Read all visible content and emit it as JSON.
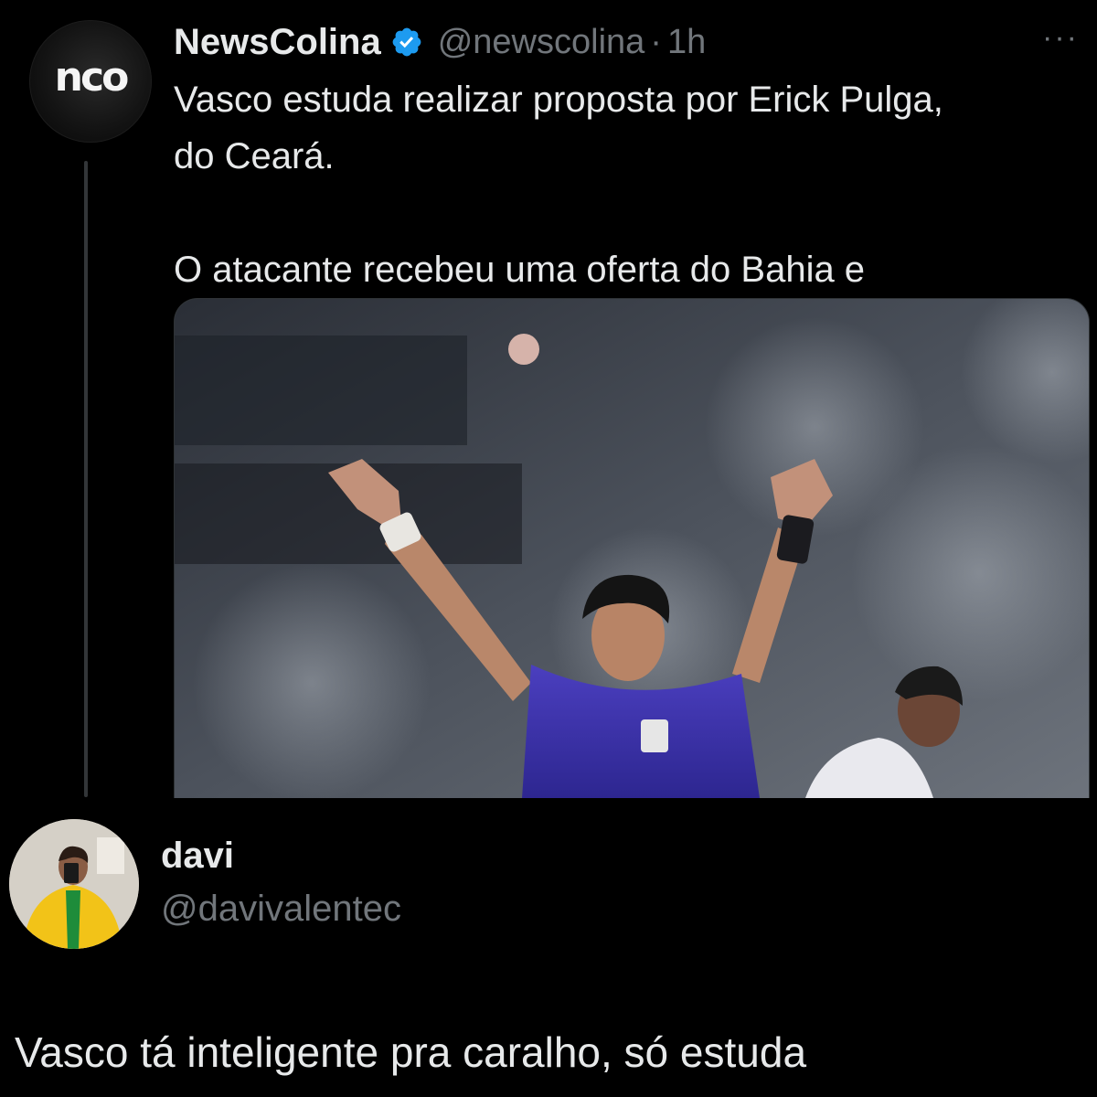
{
  "tweet": {
    "avatar_icon": "newscolina-logo",
    "avatar_logo_text": "nco",
    "display_name": "NewsColina",
    "verified_icon": "verified-badge-icon",
    "handle": "@newscolina",
    "separator": "·",
    "time": "1h",
    "more_icon": "more-options-icon",
    "more_label": "···",
    "text_line1": "Vasco estuda realizar proposta por Erick Pulga,",
    "text_line2": "do Ceará.",
    "text_line3": "O atacante recebeu uma oferta do Bahia e",
    "media_alt": "football player in blue jersey raising both arms in a stadium",
    "colors": {
      "accent": "#1d9bf0",
      "text": "#e7e9ea",
      "muted": "#71767b",
      "background": "#000000"
    }
  },
  "reply": {
    "avatar_icon": "user-avatar",
    "display_name": "davi",
    "handle": "@davivalentec",
    "text": "Vasco tá inteligente pra caralho, só estuda"
  }
}
